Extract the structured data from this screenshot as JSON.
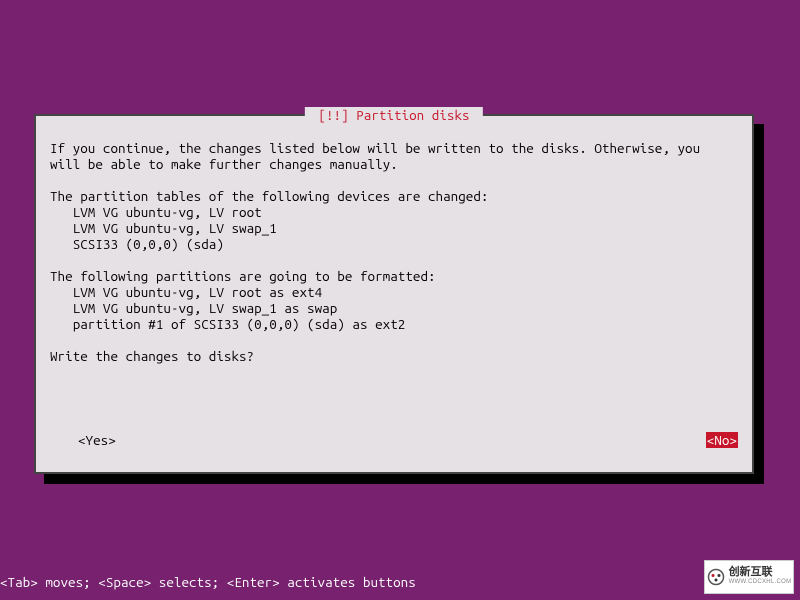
{
  "dialog": {
    "title": "[!!] Partition disks",
    "intro_l1": "If you continue, the changes listed below will be written to the disks. Otherwise, you",
    "intro_l2": "will be able to make further changes manually.",
    "changed_header": "The partition tables of the following devices are changed:",
    "changed_1": "LVM VG ubuntu-vg, LV root",
    "changed_2": "LVM VG ubuntu-vg, LV swap_1",
    "changed_3": "SCSI33 (0,0,0) (sda)",
    "format_header": "The following partitions are going to be formatted:",
    "format_1": "LVM VG ubuntu-vg, LV root as ext4",
    "format_2": "LVM VG ubuntu-vg, LV swap_1 as swap",
    "format_3": "partition #1 of SCSI33 (0,0,0) (sda) as ext2",
    "prompt": "Write the changes to disks?",
    "yes_label": "<Yes>",
    "no_label": "<No>"
  },
  "helpbar": "<Tab> moves; <Space> selects; <Enter> activates buttons",
  "watermark": {
    "main": "创新互联",
    "sub": "WWW.CDCXHL.COM"
  }
}
